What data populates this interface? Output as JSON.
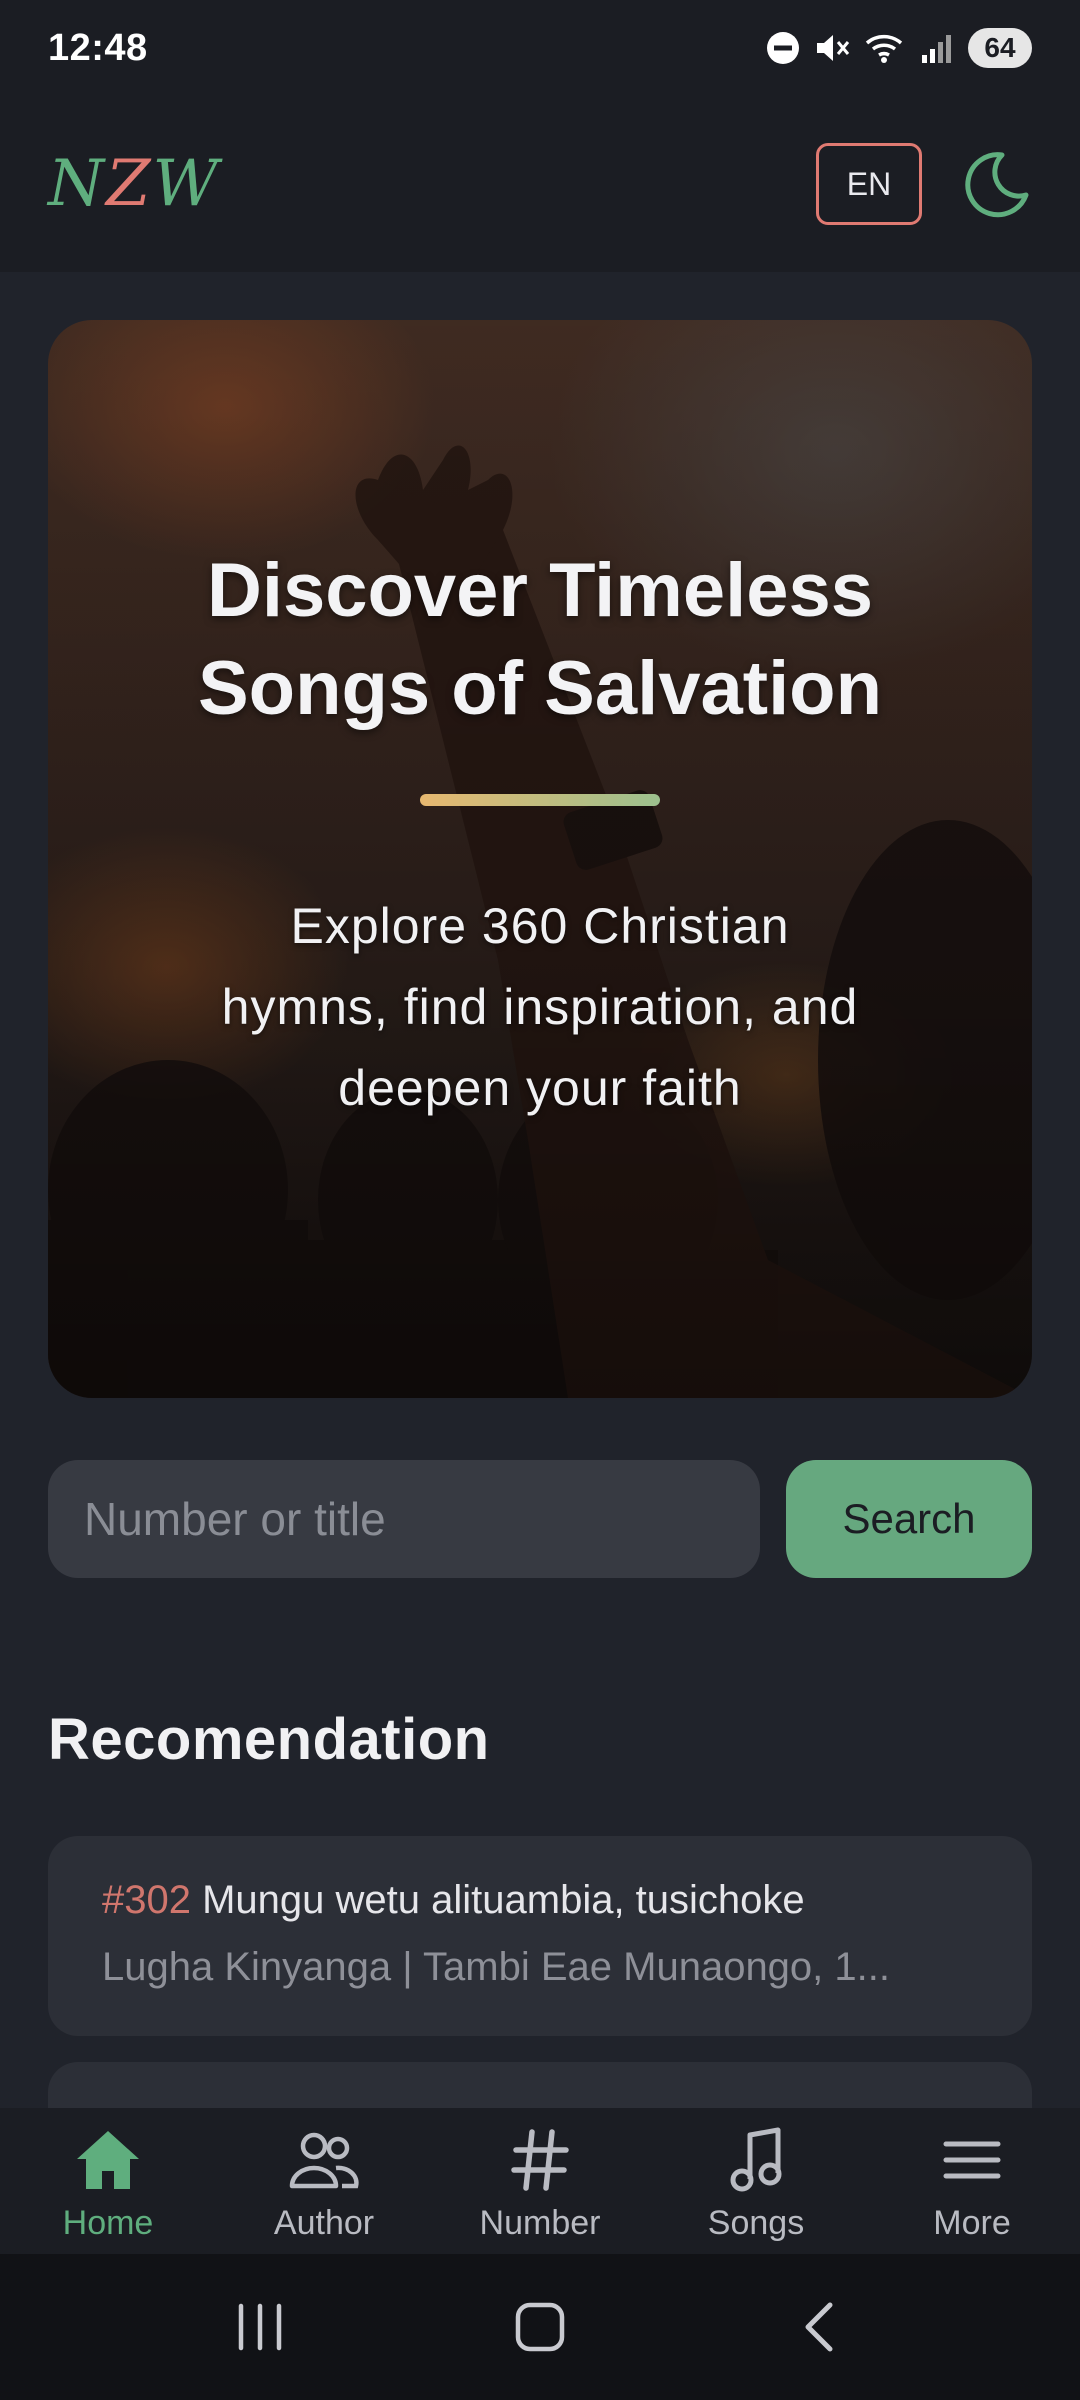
{
  "status_bar": {
    "time": "12:48",
    "battery": "64"
  },
  "header": {
    "logo": {
      "part1": "N",
      "part2": "Z",
      "part3": "W"
    },
    "language_button": "EN",
    "theme_icon": "moon-icon"
  },
  "hero": {
    "title": "Discover Timeless Songs of Salvation",
    "subtitle": "Explore 360 Christian hymns, find inspiration, and deepen your faith"
  },
  "search": {
    "placeholder": "Number or title",
    "value": "",
    "button_label": "Search"
  },
  "recommendation": {
    "title": "Recomendation",
    "items": [
      {
        "number": "#302",
        "title": "Mungu wetu alituambia, tusichoke",
        "meta": "Lugha Kinyanga | Tambi Eae Munaongo, 1..."
      },
      {
        "number": "",
        "title": "",
        "meta": ""
      }
    ]
  },
  "bottom_nav": {
    "items": [
      {
        "label": "Home",
        "icon": "home-icon",
        "active": true
      },
      {
        "label": "Author",
        "icon": "author-icon",
        "active": false
      },
      {
        "label": "Number",
        "icon": "hash-icon",
        "active": false
      },
      {
        "label": "Songs",
        "icon": "music-note-icon",
        "active": false
      },
      {
        "label": "More",
        "icon": "menu-icon",
        "active": false
      }
    ]
  },
  "colors": {
    "accent_green": "#66a87f",
    "accent_red": "#e07a72",
    "background": "#20232b",
    "header_background": "#1b1d23"
  }
}
